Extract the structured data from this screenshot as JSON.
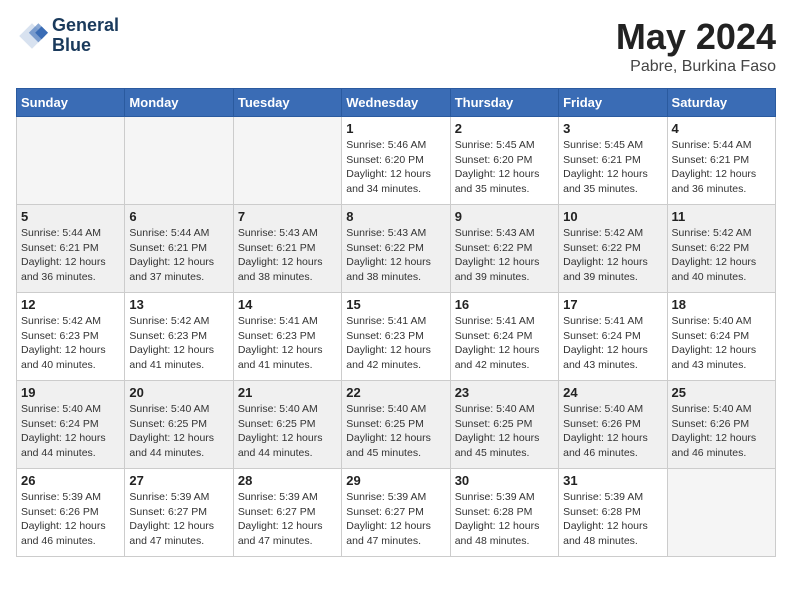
{
  "header": {
    "logo_line1": "General",
    "logo_line2": "Blue",
    "month": "May 2024",
    "location": "Pabre, Burkina Faso"
  },
  "weekdays": [
    "Sunday",
    "Monday",
    "Tuesday",
    "Wednesday",
    "Thursday",
    "Friday",
    "Saturday"
  ],
  "weeks": [
    [
      {
        "day": "",
        "info": ""
      },
      {
        "day": "",
        "info": ""
      },
      {
        "day": "",
        "info": ""
      },
      {
        "day": "1",
        "info": "Sunrise: 5:46 AM\nSunset: 6:20 PM\nDaylight: 12 hours\nand 34 minutes."
      },
      {
        "day": "2",
        "info": "Sunrise: 5:45 AM\nSunset: 6:20 PM\nDaylight: 12 hours\nand 35 minutes."
      },
      {
        "day": "3",
        "info": "Sunrise: 5:45 AM\nSunset: 6:21 PM\nDaylight: 12 hours\nand 35 minutes."
      },
      {
        "day": "4",
        "info": "Sunrise: 5:44 AM\nSunset: 6:21 PM\nDaylight: 12 hours\nand 36 minutes."
      }
    ],
    [
      {
        "day": "5",
        "info": "Sunrise: 5:44 AM\nSunset: 6:21 PM\nDaylight: 12 hours\nand 36 minutes."
      },
      {
        "day": "6",
        "info": "Sunrise: 5:44 AM\nSunset: 6:21 PM\nDaylight: 12 hours\nand 37 minutes."
      },
      {
        "day": "7",
        "info": "Sunrise: 5:43 AM\nSunset: 6:21 PM\nDaylight: 12 hours\nand 38 minutes."
      },
      {
        "day": "8",
        "info": "Sunrise: 5:43 AM\nSunset: 6:22 PM\nDaylight: 12 hours\nand 38 minutes."
      },
      {
        "day": "9",
        "info": "Sunrise: 5:43 AM\nSunset: 6:22 PM\nDaylight: 12 hours\nand 39 minutes."
      },
      {
        "day": "10",
        "info": "Sunrise: 5:42 AM\nSunset: 6:22 PM\nDaylight: 12 hours\nand 39 minutes."
      },
      {
        "day": "11",
        "info": "Sunrise: 5:42 AM\nSunset: 6:22 PM\nDaylight: 12 hours\nand 40 minutes."
      }
    ],
    [
      {
        "day": "12",
        "info": "Sunrise: 5:42 AM\nSunset: 6:23 PM\nDaylight: 12 hours\nand 40 minutes."
      },
      {
        "day": "13",
        "info": "Sunrise: 5:42 AM\nSunset: 6:23 PM\nDaylight: 12 hours\nand 41 minutes."
      },
      {
        "day": "14",
        "info": "Sunrise: 5:41 AM\nSunset: 6:23 PM\nDaylight: 12 hours\nand 41 minutes."
      },
      {
        "day": "15",
        "info": "Sunrise: 5:41 AM\nSunset: 6:23 PM\nDaylight: 12 hours\nand 42 minutes."
      },
      {
        "day": "16",
        "info": "Sunrise: 5:41 AM\nSunset: 6:24 PM\nDaylight: 12 hours\nand 42 minutes."
      },
      {
        "day": "17",
        "info": "Sunrise: 5:41 AM\nSunset: 6:24 PM\nDaylight: 12 hours\nand 43 minutes."
      },
      {
        "day": "18",
        "info": "Sunrise: 5:40 AM\nSunset: 6:24 PM\nDaylight: 12 hours\nand 43 minutes."
      }
    ],
    [
      {
        "day": "19",
        "info": "Sunrise: 5:40 AM\nSunset: 6:24 PM\nDaylight: 12 hours\nand 44 minutes."
      },
      {
        "day": "20",
        "info": "Sunrise: 5:40 AM\nSunset: 6:25 PM\nDaylight: 12 hours\nand 44 minutes."
      },
      {
        "day": "21",
        "info": "Sunrise: 5:40 AM\nSunset: 6:25 PM\nDaylight: 12 hours\nand 44 minutes."
      },
      {
        "day": "22",
        "info": "Sunrise: 5:40 AM\nSunset: 6:25 PM\nDaylight: 12 hours\nand 45 minutes."
      },
      {
        "day": "23",
        "info": "Sunrise: 5:40 AM\nSunset: 6:25 PM\nDaylight: 12 hours\nand 45 minutes."
      },
      {
        "day": "24",
        "info": "Sunrise: 5:40 AM\nSunset: 6:26 PM\nDaylight: 12 hours\nand 46 minutes."
      },
      {
        "day": "25",
        "info": "Sunrise: 5:40 AM\nSunset: 6:26 PM\nDaylight: 12 hours\nand 46 minutes."
      }
    ],
    [
      {
        "day": "26",
        "info": "Sunrise: 5:39 AM\nSunset: 6:26 PM\nDaylight: 12 hours\nand 46 minutes."
      },
      {
        "day": "27",
        "info": "Sunrise: 5:39 AM\nSunset: 6:27 PM\nDaylight: 12 hours\nand 47 minutes."
      },
      {
        "day": "28",
        "info": "Sunrise: 5:39 AM\nSunset: 6:27 PM\nDaylight: 12 hours\nand 47 minutes."
      },
      {
        "day": "29",
        "info": "Sunrise: 5:39 AM\nSunset: 6:27 PM\nDaylight: 12 hours\nand 47 minutes."
      },
      {
        "day": "30",
        "info": "Sunrise: 5:39 AM\nSunset: 6:28 PM\nDaylight: 12 hours\nand 48 minutes."
      },
      {
        "day": "31",
        "info": "Sunrise: 5:39 AM\nSunset: 6:28 PM\nDaylight: 12 hours\nand 48 minutes."
      },
      {
        "day": "",
        "info": ""
      }
    ]
  ]
}
